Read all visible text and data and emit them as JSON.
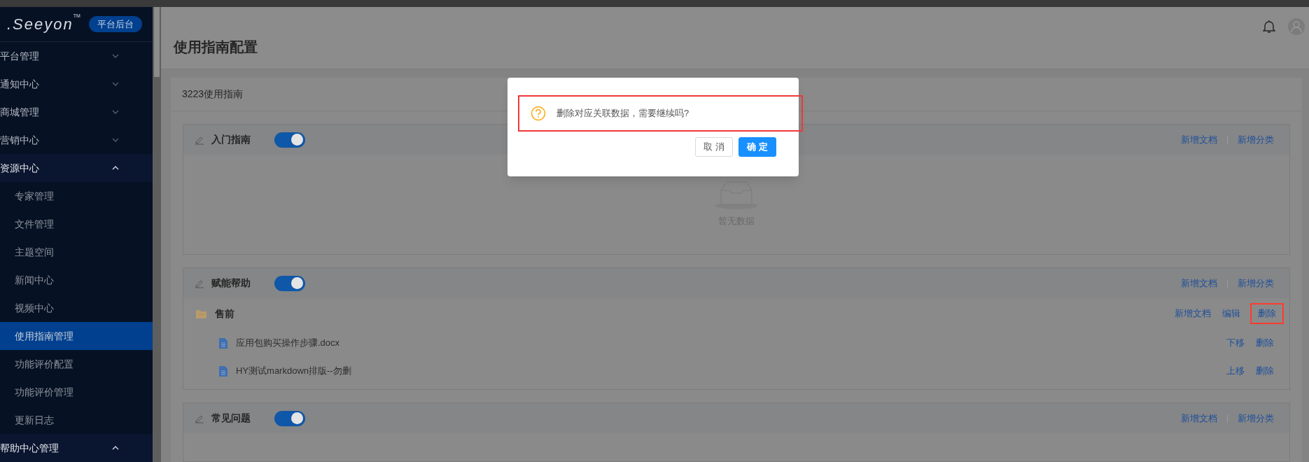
{
  "sidebar": {
    "logo": ".Seeyon",
    "logo_mark": "TM",
    "badge": "平台后台",
    "items": [
      {
        "label": "平台管理",
        "expanded": false
      },
      {
        "label": "通知中心",
        "expanded": false
      },
      {
        "label": "商城管理",
        "expanded": false
      },
      {
        "label": "营销中心",
        "expanded": false
      },
      {
        "label": "资源中心",
        "expanded": true,
        "children": [
          {
            "label": "专家管理",
            "selected": false
          },
          {
            "label": "文件管理",
            "selected": false
          },
          {
            "label": "主题空间",
            "selected": false
          },
          {
            "label": "新闻中心",
            "selected": false
          },
          {
            "label": "视频中心",
            "selected": false
          },
          {
            "label": "使用指南管理",
            "selected": true
          },
          {
            "label": "功能评价配置",
            "selected": false
          },
          {
            "label": "功能评价管理",
            "selected": false
          },
          {
            "label": "更新日志",
            "selected": false
          }
        ]
      },
      {
        "label": "帮助中心管理",
        "expanded": true
      }
    ]
  },
  "header": {
    "title": "使用指南配置"
  },
  "panel": {
    "title": "3223使用指南",
    "sections": [
      {
        "title": "入门指南",
        "on": true,
        "actions": [
          {
            "label": "新增文档",
            "highlighted": false
          },
          {
            "label": "新增分类",
            "highlighted": false
          }
        ],
        "empty_text": "暂无数据"
      },
      {
        "title": "赋能帮助",
        "on": true,
        "actions": [
          {
            "label": "新增文档",
            "highlighted": false
          },
          {
            "label": "新增分类",
            "highlighted": false
          }
        ],
        "folders": [
          {
            "name": "售前",
            "actions": [
              {
                "label": "新增文档",
                "highlighted": false
              },
              {
                "label": "编辑",
                "highlighted": false
              },
              {
                "label": "删除",
                "highlighted": true
              }
            ],
            "files": [
              {
                "name": "应用包购买操作步骤.docx",
                "actions": [
                  {
                    "label": "下移",
                    "highlighted": false
                  },
                  {
                    "label": "删除",
                    "highlighted": false
                  }
                ]
              },
              {
                "name": "HY测试markdown排版--勿删",
                "actions": [
                  {
                    "label": "上移",
                    "highlighted": false
                  },
                  {
                    "label": "删除",
                    "highlighted": false
                  }
                ]
              }
            ]
          }
        ]
      },
      {
        "title": "常见问题",
        "on": true,
        "actions": [
          {
            "label": "新增文档",
            "highlighted": false
          },
          {
            "label": "新增分类",
            "highlighted": false
          }
        ]
      }
    ]
  },
  "dialog": {
    "message": "删除对应关联数据，需要继续吗?",
    "highlighted": true,
    "buttons": [
      {
        "label": "取 消",
        "kind": "secondary"
      },
      {
        "label": "确 定",
        "kind": "primary"
      }
    ]
  }
}
